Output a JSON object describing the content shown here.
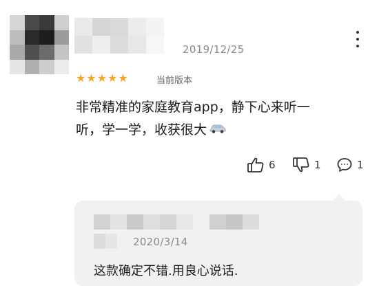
{
  "review": {
    "date": "2019/12/25",
    "rating": 5,
    "stars_text": "★★★★★",
    "version_label": "当前版本",
    "content_line1": "非常精准的家庭教育app，静下心来听一",
    "content_line2": "听，学一学，收获很大",
    "content_emoji": "car-emoji",
    "likes": "6",
    "dislikes": "1",
    "comments": "1"
  },
  "reply": {
    "date": "2020/3/14",
    "text": "这款确定不错.用良心说话."
  },
  "colors": {
    "star": "#f5a623",
    "muted_text": "#8a8a8a",
    "reply_background": "#f1f1f1"
  },
  "icons": [
    "more-options-icon",
    "thumbs-up-icon",
    "thumbs-down-icon",
    "comment-icon"
  ]
}
